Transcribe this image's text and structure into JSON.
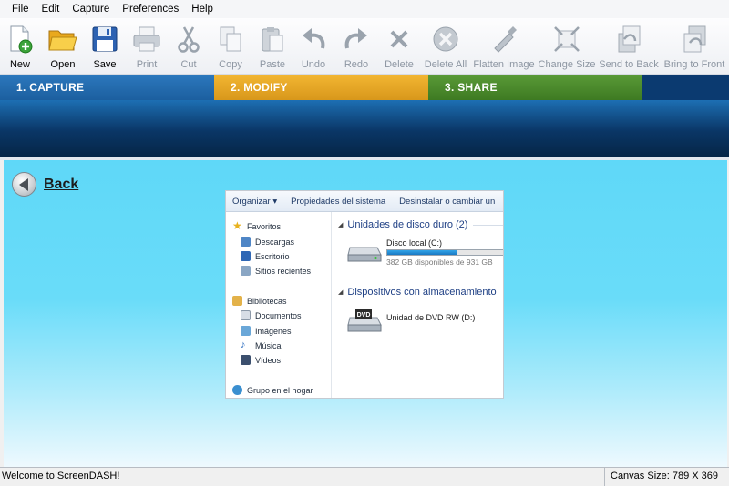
{
  "menu": [
    "File",
    "Edit",
    "Capture",
    "Preferences",
    "Help"
  ],
  "toolbar": [
    {
      "label": "New",
      "icon": "new-icon",
      "enabled": true
    },
    {
      "label": "Open",
      "icon": "open-folder-icon",
      "enabled": true
    },
    {
      "label": "Save",
      "icon": "save-disk-icon",
      "enabled": true
    },
    {
      "label": "Print",
      "icon": "print-icon",
      "enabled": false
    },
    {
      "label": "Cut",
      "icon": "scissors-icon",
      "enabled": false
    },
    {
      "label": "Copy",
      "icon": "copy-icon",
      "enabled": false
    },
    {
      "label": "Paste",
      "icon": "paste-icon",
      "enabled": false
    },
    {
      "label": "Undo",
      "icon": "undo-icon",
      "enabled": false
    },
    {
      "label": "Redo",
      "icon": "redo-icon",
      "enabled": false
    },
    {
      "label": "Delete",
      "icon": "delete-x-icon",
      "enabled": false
    },
    {
      "label": "Delete All",
      "icon": "delete-all-icon",
      "enabled": false
    },
    {
      "label": "Flatten Image",
      "icon": "flatten-icon",
      "enabled": false
    },
    {
      "label": "Change Size",
      "icon": "resize-icon",
      "enabled": false
    },
    {
      "label": "Send to Back",
      "icon": "send-back-icon",
      "enabled": false
    },
    {
      "label": "Bring to Front",
      "icon": "bring-front-icon",
      "enabled": false
    }
  ],
  "steps": {
    "capture": "1.  CAPTURE",
    "modify": "2.  MODIFY",
    "share": "3.  SHARE"
  },
  "back_label": "Back",
  "explorer": {
    "toolbar": [
      "Organizar ▾",
      "Propiedades del sistema",
      "Desinstalar o cambiar un"
    ],
    "nav": {
      "favoritos": "Favoritos",
      "descargas": "Descargas",
      "escritorio": "Escritorio",
      "sitios": "Sitios recientes",
      "bibliotecas": "Bibliotecas",
      "documentos": "Documentos",
      "imagenes": "Imágenes",
      "musica": "Música",
      "videos": "Vídeos",
      "grupo": "Grupo en el hogar"
    },
    "group_hdd": "Unidades de disco duro (2)",
    "drive_c": {
      "name": "Disco local (C:)",
      "space": "382 GB disponibles de 931 GB",
      "used_fraction": 0.59
    },
    "group_removable": "Dispositivos con almacenamiento",
    "drive_d": {
      "name": "Unidad de DVD RW (D:)",
      "badge": "DVD"
    }
  },
  "status": {
    "welcome": "Welcome to ScreenDASH!",
    "canvas_size": "Canvas Size: 789 X 369"
  },
  "colors": {
    "capture": "#1f64a6",
    "modify": "#e3a526",
    "share": "#4b8a2c",
    "canvas": "#66dbf9"
  }
}
